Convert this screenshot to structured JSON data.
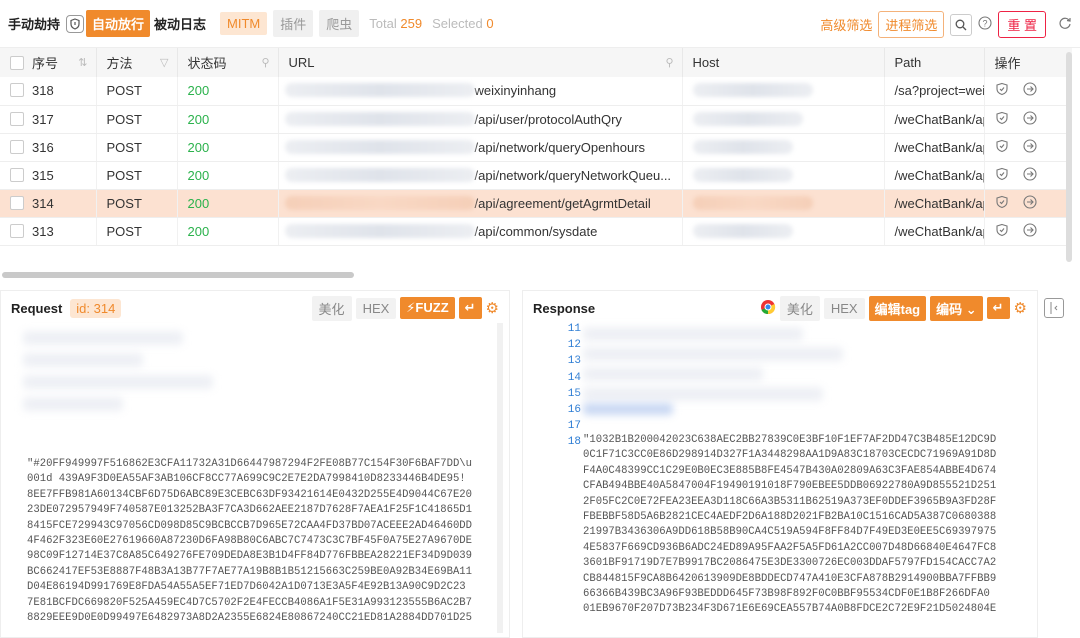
{
  "toolbar": {
    "manual_hold": "手动劫持",
    "auto_release": "自动放行",
    "passive_log": "被动日志",
    "mitm": "MITM",
    "plugins": "插件",
    "crawler": "爬虫",
    "total_label": "Total",
    "total_value": "259",
    "selected_label": "Selected",
    "selected_value": "0",
    "advanced_filter": "高级筛选",
    "process_filter": "进程筛选",
    "reset": "重 置"
  },
  "table": {
    "headers": [
      "序号",
      "方法",
      "状态码",
      "URL",
      "Host",
      "Path",
      "操作"
    ],
    "rows": [
      {
        "id": "318",
        "method": "POST",
        "status": "200",
        "url": "weixinyinhang",
        "path": "/sa?project=wei:"
      },
      {
        "id": "317",
        "method": "POST",
        "status": "200",
        "url": "/api/user/protocolAuthQry",
        "path": "/weChatBank/ap"
      },
      {
        "id": "316",
        "method": "POST",
        "status": "200",
        "url": "/api/network/queryOpenhours",
        "path": "/weChatBank/ap"
      },
      {
        "id": "315",
        "method": "POST",
        "status": "200",
        "url": "/api/network/queryNetworkQueu...",
        "path": "/weChatBank/ap"
      },
      {
        "id": "314",
        "method": "POST",
        "status": "200",
        "url": "/api/agreement/getAgrmtDetail",
        "path": "/weChatBank/ap",
        "selected": true
      },
      {
        "id": "313",
        "method": "POST",
        "status": "200",
        "url": "/api/common/sysdate",
        "path": "/weChatBank/ap"
      }
    ]
  },
  "request": {
    "title": "Request",
    "id_badge": "id: 314",
    "beautify": "美化",
    "hex": "HEX",
    "fuzz": "⚡FUZZ",
    "body": "\"#20FF949997F516862E3CFA11732A31D66447987294F2FE08B77C154F30F6BAF7DD\\u\n001d \u001c439A9F3D0EA55AF3AB106CF8CC77A699C9C2E7E2DA7998410D8233446B4DE95!\n8EE7FFB981A60134CBF6D75D6ABC89E3CEBC63DF93421614E0432D255E4D9044C67E20\n23DE072957949F740587E013252BA3F7CA3D662AEE2187D7628F7AEA1F25F1C41865D1\n8415FCE729943C97056CD098D85C9BCBCCB7D965E72CAA4FD37BD07ACEEE2AD46460DD\n4F462F323E60E27619660A87230D6FA98B80C6ABC7C7473C3C7BF45F0A75E27A9670DE\n98C09F12714E37C8A85C649276FE709DEDA8E3B1D4FF84D776FBBEA28221EF34D9D039\nBC662417EF53E8887F48B3A13B77F7AE77A19B8B1B51215663C259BE0A92B34E69BA11\nD04E86194D991769E8FDA54A55A5EF71ED7D6042A1D0713E3A5F4E92B13A90C9D2C23\n7E81BCFDC669820F525A459EC4D7C5702F2E4FECCB4086A1F5E31A993123555B6AC2B7\n8829EEE9D0E0D99497E6482973A8D2A2355E6824E80867240CC21ED81A2884DD701D25"
  },
  "response": {
    "title": "Response",
    "beautify": "美化",
    "hex": "HEX",
    "edit_tag": "编辑tag",
    "encoding": "编码 ⌄",
    "line_numbers": [
      "11",
      "12",
      "13",
      "14",
      "15",
      "16",
      "17",
      "18"
    ],
    "body": "\"1032B1B200042023C638AEC2BB27839C0E3BF10F1EF7AF2DD47C3B485E12DC9D\n0C1F71C3CC0E86D298914D327F1A3448298AA1D9A83C18703CECDC71969A91D8D\nF4A0C48399CC1C29E0B0EC3E885B8FE4547B430A02809A63C3FAE854ABBE4D674\nCFAB494BBE40A5847004F19490191018F790EBEE5DDB06922780A9D855521D251\n2F05FC2C0E72FEA23EEA3D118C66A3B5311B62519A373EF0DDEF3965B9A3FD28F\nFBEBBF58D5A6B2821CEC4AEDF2D6A188D2021FB2BA10C1516CAD5A387C0680388\n21997B3436306A9DD618B58B90CA4C519A594F8FF84D7F49ED3E0EE5C69397975\n4E5837F669CD936B6ADC24ED89A95FAA2F5A5FD61A2CC007D48D66840E4647FC8\n3601BF91719D7E7B9917BC2086475E3DE3300726EC003DDAF5797FD154CACC7A2\nCB844815F9CA8B6420613909DE8BDDECD747A410E3CFA878B2914900BBA7FFBB9\n66366B439BC3A96F93BEDDD645F73B98F892F0C0BBF95534CDF0E1B8F266DFA0\n01EB9670F207D73B234F3D671E6E69CEA557B74A0B8FDCE2C72E9F21D5024804E"
  }
}
